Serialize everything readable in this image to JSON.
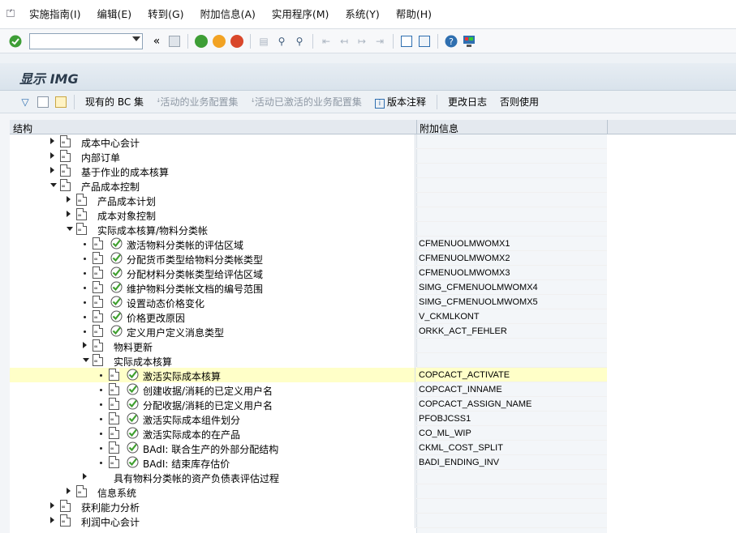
{
  "menubar": {
    "items": [
      "实施指南(I)",
      "编辑(E)",
      "转到(G)",
      "附加信息(A)",
      "实用程序(M)",
      "系统(Y)",
      "帮助(H)"
    ]
  },
  "title": "显示 IMG",
  "app_toolbar": {
    "bc_sets": "现有的 BC 集",
    "active_bc": "活动的业务配置集",
    "activated_bc": "活动已激活的业务配置集",
    "release_notes": "版本注释",
    "change_log": "更改日志",
    "else_use": "否则使用"
  },
  "tree": {
    "col_structure": "结构",
    "col_info": "附加信息",
    "rows": [
      {
        "label": "成本中心会计",
        "info": "",
        "level": 0,
        "node": "collapsed",
        "exec": false
      },
      {
        "label": "内部订单",
        "info": "",
        "level": 0,
        "node": "collapsed",
        "exec": false
      },
      {
        "label": "基于作业的成本核算",
        "info": "",
        "level": 0,
        "node": "collapsed",
        "exec": false
      },
      {
        "label": "产品成本控制",
        "info": "",
        "level": 0,
        "node": "expanded",
        "exec": false
      },
      {
        "label": "产品成本计划",
        "info": "",
        "level": 1,
        "node": "collapsed",
        "exec": false
      },
      {
        "label": "成本对象控制",
        "info": "",
        "level": 1,
        "node": "collapsed",
        "exec": false
      },
      {
        "label": "实际成本核算/物料分类帐",
        "info": "",
        "level": 1,
        "node": "expanded",
        "exec": false
      },
      {
        "label": "激活物料分类帐的评估区域",
        "info": "CFMENUOLMWOMX1",
        "level": 2,
        "node": "leaf",
        "exec": true
      },
      {
        "label": "分配货币类型给物料分类帐类型",
        "info": "CFMENUOLMWOMX2",
        "level": 2,
        "node": "leaf",
        "exec": true
      },
      {
        "label": "分配材料分类帐类型给评估区域",
        "info": "CFMENUOLMWOMX3",
        "level": 2,
        "node": "leaf",
        "exec": true
      },
      {
        "label": "维护物料分类帐文档的编号范围",
        "info": "SIMG_CFMENUOLMWOMX4",
        "level": 2,
        "node": "leaf",
        "exec": true
      },
      {
        "label": "设置动态价格变化",
        "info": "SIMG_CFMENUOLMWOMX5",
        "level": 2,
        "node": "leaf",
        "exec": true
      },
      {
        "label": "价格更改原因",
        "info": "V_CKMLKONT",
        "level": 2,
        "node": "leaf",
        "exec": true
      },
      {
        "label": "定义用户定义消息类型",
        "info": "ORKK_ACT_FEHLER",
        "level": 2,
        "node": "leaf",
        "exec": true
      },
      {
        "label": "物料更新",
        "info": "",
        "level": 2,
        "node": "collapsed",
        "exec": false
      },
      {
        "label": "实际成本核算",
        "info": "",
        "level": 2,
        "node": "expanded",
        "exec": false
      },
      {
        "label": "激活实际成本核算",
        "info": "COPCACT_ACTIVATE",
        "level": 3,
        "node": "leaf",
        "exec": true,
        "highlight": true
      },
      {
        "label": "创建收据/消耗的已定义用户名",
        "info": "COPCACT_INNAME",
        "level": 3,
        "node": "leaf",
        "exec": true
      },
      {
        "label": "分配收据/消耗的已定义用户名",
        "info": "COPCACT_ASSIGN_NAME",
        "level": 3,
        "node": "leaf",
        "exec": true
      },
      {
        "label": "激活实际成本组件划分",
        "info": "PFOBJCSS1",
        "level": 3,
        "node": "leaf",
        "exec": true
      },
      {
        "label": "激活实际成本的在产品",
        "info": "CO_ML_WIP",
        "level": 3,
        "node": "leaf",
        "exec": true
      },
      {
        "label": "BAdI: 联合生产的外部分配结构",
        "info": "CKML_COST_SPLIT",
        "level": 3,
        "node": "leaf",
        "exec": true
      },
      {
        "label": "BAdI: 结束库存估价",
        "info": "BADI_ENDING_INV",
        "level": 3,
        "node": "leaf",
        "exec": true
      },
      {
        "label": "具有物料分类帐的资产负债表评估过程",
        "info": "",
        "level": 2,
        "node": "collapsed",
        "exec": false,
        "nodoc": true
      },
      {
        "label": "信息系统",
        "info": "",
        "level": 1,
        "node": "collapsed",
        "exec": false
      },
      {
        "label": "获利能力分析",
        "info": "",
        "level": 0,
        "node": "collapsed",
        "exec": false
      },
      {
        "label": "利润中心会计",
        "info": "",
        "level": 0,
        "node": "collapsed",
        "exec": false
      }
    ]
  },
  "colors": {
    "highlight_row": "#ffffc8",
    "callout_box": "#e0282a",
    "exec_green": "#3f9f2f"
  }
}
